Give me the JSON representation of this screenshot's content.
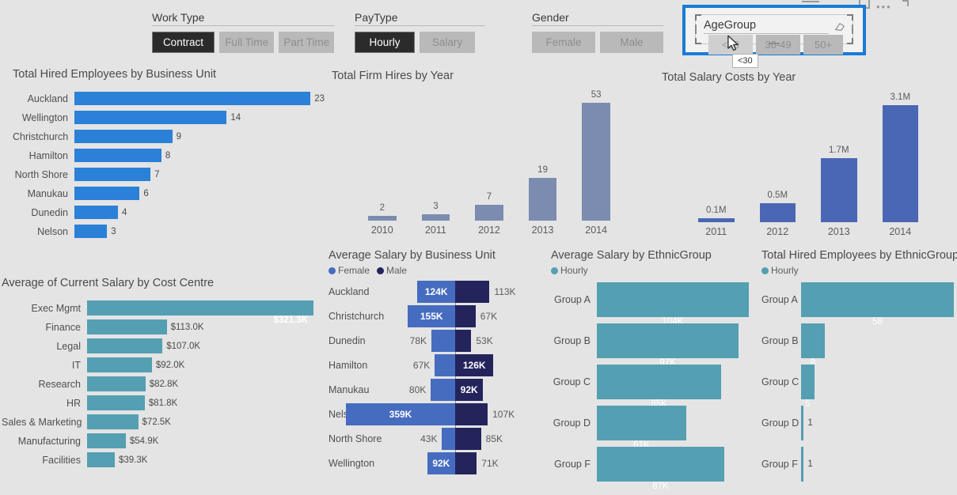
{
  "chrome": {
    "focus_icon": "focus-mode-icon",
    "more_icon": "more-options-icon",
    "minimize_icon": "minimize-icon"
  },
  "slicers": [
    {
      "name": "work-type",
      "title": "Work Type",
      "options": [
        {
          "label": "Contract",
          "state": "selected"
        },
        {
          "label": "Full Time",
          "state": "normal"
        },
        {
          "label": "Part Time",
          "state": "normal"
        }
      ]
    },
    {
      "name": "pay-type",
      "title": "PayType",
      "options": [
        {
          "label": "Hourly",
          "state": "selected"
        },
        {
          "label": "Salary",
          "state": "normal"
        }
      ]
    },
    {
      "name": "gender",
      "title": "Gender",
      "options": [
        {
          "label": "Female",
          "state": "normal"
        },
        {
          "label": "Male",
          "state": "normal"
        }
      ]
    }
  ],
  "agegroup_slicer": {
    "title": "AgeGroup",
    "clear_icon": "eraser-icon",
    "cursor": "mouse-cursor",
    "tooltip": "<30",
    "options": [
      {
        "label": "<30",
        "state": "hovered"
      },
      {
        "label": "30-49",
        "state": "normal"
      },
      {
        "label": "50+",
        "state": "normal"
      }
    ]
  },
  "colors": {
    "background": "#e4e4e4",
    "blue": "#2b80d8",
    "teal": "#549fb2",
    "slate": "#7b8cb0",
    "royal": "#4a67b5",
    "navy": "#23245c",
    "female": "#466cc0",
    "highlight_border": "#1a7bd4"
  },
  "chart_data": [
    {
      "id": "hired-by-business-unit",
      "type": "bar",
      "orientation": "horizontal",
      "title": "Total Hired Employees by Business Unit",
      "xlabel": "",
      "ylabel": "",
      "color": "#2b80d8",
      "grid": false,
      "legend": null,
      "max": 23,
      "categories": [
        "Auckland",
        "Wellington",
        "Christchurch",
        "Hamilton",
        "North Shore",
        "Manukau",
        "Dunedin",
        "Nelson"
      ],
      "values": [
        23,
        14,
        9,
        8,
        7,
        6,
        4,
        3
      ],
      "labels": [
        "23",
        "14",
        "9",
        "8",
        "7",
        "6",
        "4",
        "3"
      ]
    },
    {
      "id": "avg-salary-by-cost-centre",
      "type": "bar",
      "orientation": "horizontal",
      "title": "Average of Current Salary by Cost Centre",
      "xlabel": "",
      "ylabel": "",
      "color": "#549fb2",
      "grid": false,
      "legend": null,
      "max": 321.3,
      "categories": [
        "Exec Mgmt",
        "Finance",
        "Legal",
        "IT",
        "Research",
        "HR",
        "Sales & Marketing",
        "Manufacturing",
        "Facilities"
      ],
      "values": [
        321.3,
        113.0,
        107.0,
        92.0,
        82.8,
        81.8,
        72.5,
        54.9,
        39.3
      ],
      "labels": [
        "$321.3K",
        "$113.0K",
        "$107.0K",
        "$92.0K",
        "$82.8K",
        "$81.8K",
        "$72.5K",
        "$54.9K",
        "$39.3K"
      ],
      "label_inside": [
        true,
        false,
        false,
        false,
        false,
        false,
        false,
        false,
        false
      ]
    },
    {
      "id": "firm-hires-by-year",
      "type": "bar",
      "orientation": "vertical",
      "title": "Total Firm Hires by Year",
      "xlabel": "",
      "ylabel": "",
      "color": "#7b8cb0",
      "grid": false,
      "legend": null,
      "max": 53,
      "categories": [
        "2010",
        "2011",
        "2012",
        "2013",
        "2014"
      ],
      "values": [
        2,
        3,
        7,
        19,
        53
      ],
      "labels": [
        "2",
        "3",
        "7",
        "19",
        "53"
      ]
    },
    {
      "id": "salary-costs-by-year",
      "type": "bar",
      "orientation": "vertical",
      "title": "Total Salary Costs by Year",
      "xlabel": "",
      "ylabel": "",
      "color": "#4a67b5",
      "grid": false,
      "legend": null,
      "max": 3.1,
      "categories": [
        "2011",
        "2012",
        "2013",
        "2014"
      ],
      "values": [
        0.1,
        0.5,
        1.7,
        3.1
      ],
      "labels": [
        "0.1M",
        "0.5M",
        "1.7M",
        "3.1M"
      ]
    },
    {
      "id": "avg-salary-by-business-unit",
      "type": "bar",
      "orientation": "tornado",
      "title": "Average Salary by Business Unit",
      "xlabel": "",
      "ylabel": "",
      "grid": false,
      "legend": [
        {
          "name": "Female",
          "color": "#466cc0"
        },
        {
          "name": "Male",
          "color": "#23245c"
        }
      ],
      "max": 359,
      "categories": [
        "Auckland",
        "Christchurch",
        "Dunedin",
        "Hamilton",
        "Manukau",
        "Nelson",
        "North Shore",
        "Wellington"
      ],
      "series": [
        {
          "name": "Female",
          "values": [
            124,
            155,
            78,
            67,
            80,
            359,
            43,
            92
          ],
          "labels": [
            "124K",
            "155K",
            "78K",
            "67K",
            "80K",
            "359K",
            "43K",
            "92K"
          ],
          "label_inside": [
            true,
            true,
            false,
            false,
            false,
            true,
            false,
            true
          ]
        },
        {
          "name": "Male",
          "values": [
            113,
            67,
            53,
            126,
            92,
            107,
            85,
            71
          ],
          "labels": [
            "113K",
            "67K",
            "53K",
            "126K",
            "92K",
            "107K",
            "85K",
            "71K"
          ],
          "label_inside": [
            false,
            false,
            false,
            true,
            true,
            false,
            false,
            false
          ]
        }
      ]
    },
    {
      "id": "avg-salary-by-ethnicgroup",
      "type": "bar",
      "orientation": "horizontal",
      "title": "Average Salary by EthnicGroup",
      "xlabel": "",
      "ylabel": "",
      "color": "#549fb2",
      "grid": false,
      "legend": [
        {
          "name": "Hourly",
          "color": "#549fb2"
        }
      ],
      "max": 104,
      "categories": [
        "Group A",
        "Group B",
        "Group C",
        "Group D",
        "Group F"
      ],
      "values": [
        104,
        97,
        85,
        61,
        87
      ],
      "labels": [
        "104K",
        "97K",
        "85K",
        "61K",
        "87K"
      ],
      "label_inside": [
        true,
        true,
        true,
        true,
        true
      ]
    },
    {
      "id": "hired-by-ethnicgroup",
      "type": "bar",
      "orientation": "horizontal",
      "title": "Total Hired Employees by EthnicGroup",
      "xlabel": "",
      "ylabel": "",
      "color": "#549fb2",
      "grid": false,
      "legend": [
        {
          "name": "Hourly",
          "color": "#549fb2"
        }
      ],
      "max": 58,
      "categories": [
        "Group A",
        "Group B",
        "Group C",
        "Group D",
        "Group F"
      ],
      "values": [
        58,
        9,
        5,
        1,
        1
      ],
      "labels": [
        "58",
        "9",
        "5",
        "1",
        "1"
      ],
      "label_inside": [
        true,
        true,
        true,
        false,
        false
      ]
    }
  ]
}
